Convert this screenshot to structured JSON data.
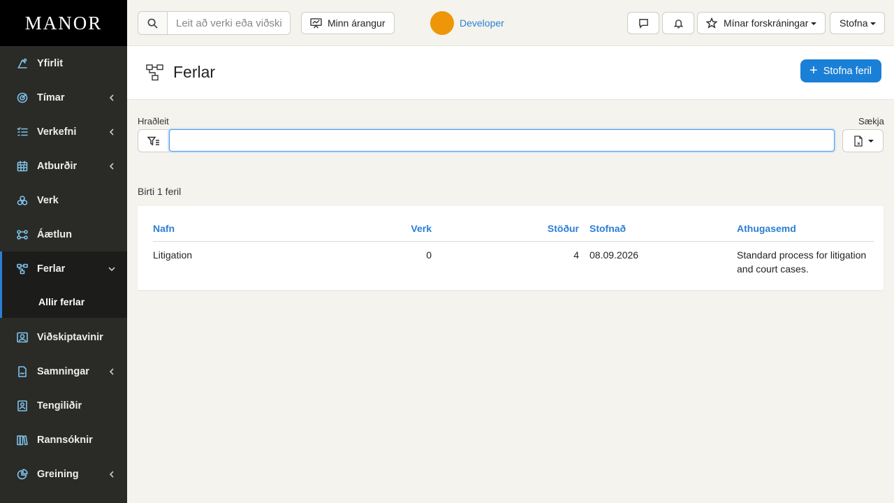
{
  "brand": "MANOR",
  "sidebar": {
    "items": [
      {
        "label": "Yfirlit",
        "icon": "dashboard-icon",
        "has_chevron": false
      },
      {
        "label": "Tímar",
        "icon": "clock-target-icon",
        "has_chevron": true
      },
      {
        "label": "Verkefni",
        "icon": "task-list-icon",
        "has_chevron": true
      },
      {
        "label": "Atburðir",
        "icon": "calendar-icon",
        "has_chevron": true
      },
      {
        "label": "Verk",
        "icon": "cases-icon",
        "has_chevron": false
      },
      {
        "label": "Áætlun",
        "icon": "plan-icon",
        "has_chevron": false
      },
      {
        "label": "Ferlar",
        "icon": "workflow-icon",
        "has_chevron": true,
        "open": true
      },
      {
        "label": "Viðskiptavinir",
        "icon": "clients-icon",
        "has_chevron": false
      },
      {
        "label": "Samningar",
        "icon": "contract-icon",
        "has_chevron": true
      },
      {
        "label": "Tengiliðir",
        "icon": "contact-card-icon",
        "has_chevron": false
      },
      {
        "label": "Rannsóknir",
        "icon": "books-icon",
        "has_chevron": false
      },
      {
        "label": "Greining",
        "icon": "pie-chart-icon",
        "has_chevron": true
      }
    ],
    "subitem": "Allir ferlar"
  },
  "topbar": {
    "search_placeholder": "Leit að verki eða viðskiptavini",
    "performance_label": "Minn árangur",
    "user_name": "Developer",
    "avatar_color": "#ee9607",
    "favorites_label": "Mínar forskráningar",
    "create_label": "Stofna"
  },
  "header": {
    "title": "Ferlar",
    "new_button": "Stofna feril"
  },
  "filters": {
    "quick_label": "Hraðleit",
    "fetch_label": "Sækja",
    "quick_value": ""
  },
  "results": {
    "count_text": "Birti 1 feril"
  },
  "table": {
    "headers": {
      "name": "Nafn",
      "cases": "Verk",
      "stages": "Stöður",
      "created": "Stofnað",
      "note": "Athugasemd"
    },
    "rows": [
      {
        "name": "Litigation",
        "cases": "0",
        "stages": "4",
        "created": "08.09.2026",
        "note": "Standard process for litigation and court cases."
      }
    ]
  },
  "colors": {
    "accent": "#2b7fd4",
    "primary_button": "#1a7fd6",
    "sidebar": "#2a2a27"
  }
}
